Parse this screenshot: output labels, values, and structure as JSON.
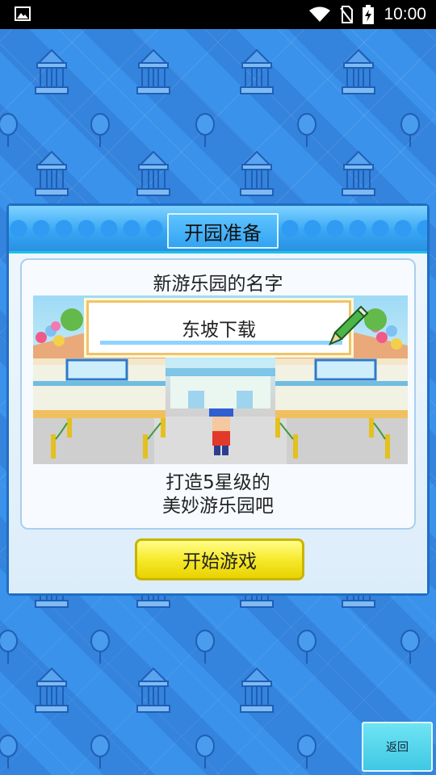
{
  "status_bar": {
    "time": "10:00"
  },
  "dialog": {
    "title": "开园准备",
    "park_name_label": "新游乐园的名字",
    "park_name_value": "东坡下载",
    "tagline_line1": "打造5星级的",
    "tagline_line2": "美妙游乐园吧",
    "start_button_label": "开始游戏"
  },
  "back_button_label": "返回",
  "colors": {
    "background": "#3a8ee6",
    "dialog_border": "#1f6ec5",
    "header": "#38a7f4",
    "start_button": "#f7ea2d",
    "back_button": "#3fc8e4"
  },
  "icons": [
    "image-icon",
    "wifi-icon",
    "no-sim-icon",
    "battery-charging-icon",
    "pencil-icon",
    "balloon-icon",
    "carousel-icon"
  ]
}
